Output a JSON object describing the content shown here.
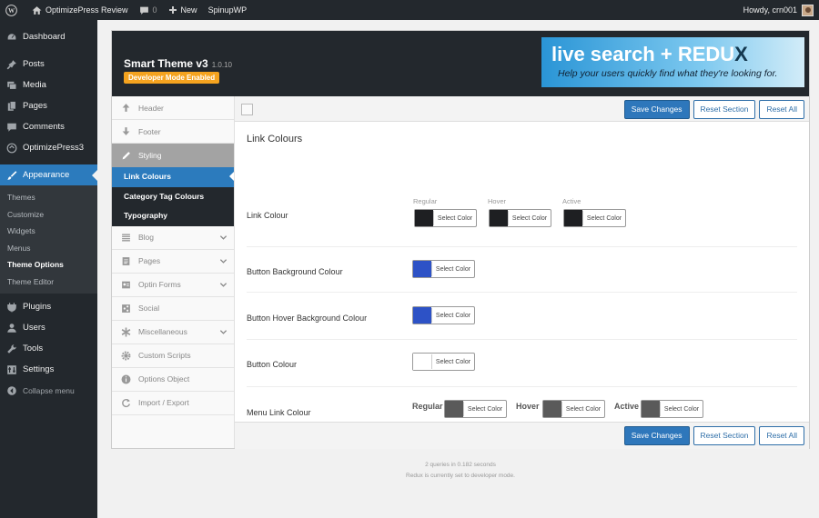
{
  "adminbar": {
    "site_name": "OptimizePress Review",
    "comments_count": "0",
    "new_label": "New",
    "spinup_label": "SpinupWP",
    "howdy": "Howdy, crn001"
  },
  "sidebar": {
    "items": [
      {
        "label": "Dashboard",
        "icon": "dashboard-icon"
      },
      {
        "label": "Posts",
        "icon": "pin-icon"
      },
      {
        "label": "Media",
        "icon": "media-icon"
      },
      {
        "label": "Pages",
        "icon": "pages-icon"
      },
      {
        "label": "Comments",
        "icon": "comment-icon"
      },
      {
        "label": "OptimizePress3",
        "icon": "op-icon"
      },
      {
        "label": "Appearance",
        "icon": "brush-icon"
      }
    ],
    "submenu": [
      "Themes",
      "Customize",
      "Widgets",
      "Menus",
      "Theme Options",
      "Theme Editor"
    ],
    "items2": [
      {
        "label": "Plugins",
        "icon": "plug-icon"
      },
      {
        "label": "Users",
        "icon": "user-icon"
      },
      {
        "label": "Tools",
        "icon": "wrench-icon"
      },
      {
        "label": "Settings",
        "icon": "settings-icon"
      },
      {
        "label": "Collapse menu",
        "icon": "collapse-icon"
      }
    ]
  },
  "panel": {
    "title": "Smart Theme v3",
    "version": "1.0.10",
    "dev_badge": "Developer Mode Enabled",
    "banner_main": "live search + REDU",
    "banner_x": "X",
    "banner_sub": "Help your users quickly find what they're looking for."
  },
  "buttons": {
    "save": "Save Changes",
    "reset_section": "Reset Section",
    "reset_all": "Reset All"
  },
  "nav": {
    "items_top": [
      "Header",
      "Footer",
      "Styling"
    ],
    "styling_sub": [
      "Link Colours",
      "Category Tag Colours",
      "Typography"
    ],
    "items_bottom": [
      "Blog",
      "Pages",
      "Optin Forms",
      "Social",
      "Miscellaneous",
      "Custom Scripts",
      "Options Object",
      "Import / Export"
    ]
  },
  "content": {
    "section_title": "Link Colours",
    "select_color": "Select Color",
    "rows": [
      {
        "label": "Link Colour",
        "sub_labels": [
          "Regular",
          "Hover",
          "Active"
        ],
        "colors": [
          "#1e1f22",
          "#1e1f22",
          "#1e1f22"
        ]
      },
      {
        "label": "Button Background Colour",
        "colors": [
          "#2d52c6"
        ]
      },
      {
        "label": "Button Hover Background Colour",
        "colors": [
          "#2d52c6"
        ]
      },
      {
        "label": "Button Colour",
        "colors": [
          "#ffffff"
        ]
      },
      {
        "label": "Menu Link Colour",
        "sub_labels": [
          "Regular",
          "Hover",
          "Active"
        ],
        "colors": [
          "#5a5a5a",
          "#5a5a5a",
          "#5a5a5a"
        ]
      }
    ]
  },
  "footer": {
    "line1": "2 queries in 0.182 seconds",
    "line2": "Redux is currently set to developer mode."
  }
}
